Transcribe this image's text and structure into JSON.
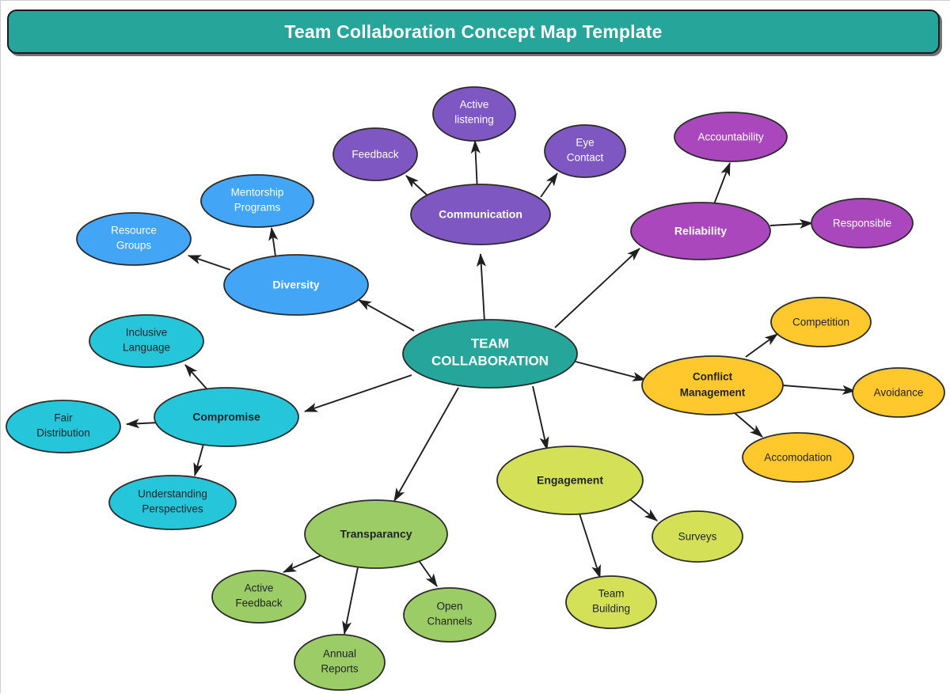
{
  "banner": {
    "title": "Team Collaboration Concept Map Template",
    "bg_color": "#26A69A",
    "text_color": "#FFFFFF"
  },
  "palette": {
    "teal": "#26A69A",
    "purple": "#7E57C2",
    "magenta": "#AB47BC",
    "amber": "#FFC82C",
    "lime": "#D4E157",
    "green": "#9CCC65",
    "cyan": "#26C6DA",
    "blue": "#42A5F5",
    "stroke": "#2B2B2B",
    "light_text": "#FFFFFF",
    "dark_text": "#1F2328"
  },
  "chart_data": {
    "type": "diagram",
    "title": "Team Collaboration Concept Map Template",
    "root": "TEAM COLLABORATION",
    "branches": [
      {
        "name": "Communication",
        "color": "#7E57C2",
        "text_color": "#FFFFFF",
        "children": [
          "Active listening",
          "Feedback",
          "Eye Contact"
        ]
      },
      {
        "name": "Reliability",
        "color": "#AB47BC",
        "text_color": "#FFFFFF",
        "children": [
          "Accountability",
          "Responsible"
        ]
      },
      {
        "name": "Conflict Management",
        "color": "#FFC82C",
        "text_color": "#1F2328",
        "children": [
          "Competition",
          "Avoidance",
          "Accomodation"
        ]
      },
      {
        "name": "Engagement",
        "color": "#D4E157",
        "text_color": "#1F2328",
        "children": [
          "Surveys",
          "Team Building"
        ]
      },
      {
        "name": "Transparancy",
        "color": "#9CCC65",
        "text_color": "#1F2328",
        "children": [
          "Active Feedback",
          "Annual Reports",
          "Open Channels"
        ]
      },
      {
        "name": "Compromise",
        "color": "#26C6DA",
        "text_color": "#1F2328",
        "children": [
          "Inclusive Language",
          "Fair Distribution",
          "Understanding Perspectives"
        ]
      },
      {
        "name": "Diversity",
        "color": "#42A5F5",
        "text_color": "#FFFFFF",
        "children": [
          "Mentorship Programs",
          "Resource Groups"
        ]
      }
    ]
  },
  "nodes": {
    "root": {
      "label_line1": "TEAM",
      "label_line2": "COLLABORATION"
    },
    "communication": {
      "label": "Communication"
    },
    "active_listening": {
      "label_line1": "Active",
      "label_line2": "listening"
    },
    "feedback": {
      "label": "Feedback"
    },
    "eye_contact": {
      "label_line1": "Eye",
      "label_line2": "Contact"
    },
    "reliability": {
      "label": "Reliability"
    },
    "accountability": {
      "label": "Accountability"
    },
    "responsible": {
      "label": "Responsible"
    },
    "conflict_management": {
      "label_line1": "Conflict",
      "label_line2": "Management"
    },
    "competition": {
      "label": "Competition"
    },
    "avoidance": {
      "label": "Avoidance"
    },
    "accomodation": {
      "label": "Accomodation"
    },
    "engagement": {
      "label": "Engagement"
    },
    "surveys": {
      "label": "Surveys"
    },
    "team_building": {
      "label_line1": "Team",
      "label_line2": "Building"
    },
    "transparancy": {
      "label": "Transparancy"
    },
    "active_feedback": {
      "label_line1": "Active",
      "label_line2": "Feedback"
    },
    "annual_reports": {
      "label_line1": "Annual",
      "label_line2": "Reports"
    },
    "open_channels": {
      "label_line1": "Open",
      "label_line2": "Channels"
    },
    "compromise": {
      "label": "Compromise"
    },
    "inclusive_language": {
      "label_line1": "Inclusive",
      "label_line2": "Language"
    },
    "fair_distribution": {
      "label_line1": "Fair",
      "label_line2": "Distribution"
    },
    "understanding_perspectives": {
      "label_line1": "Understanding",
      "label_line2": "Perspectives"
    },
    "diversity": {
      "label": "Diversity"
    },
    "mentorship_programs": {
      "label_line1": "Mentorship",
      "label_line2": "Programs"
    },
    "resource_groups": {
      "label_line1": "Resource",
      "label_line2": "Groups"
    }
  }
}
